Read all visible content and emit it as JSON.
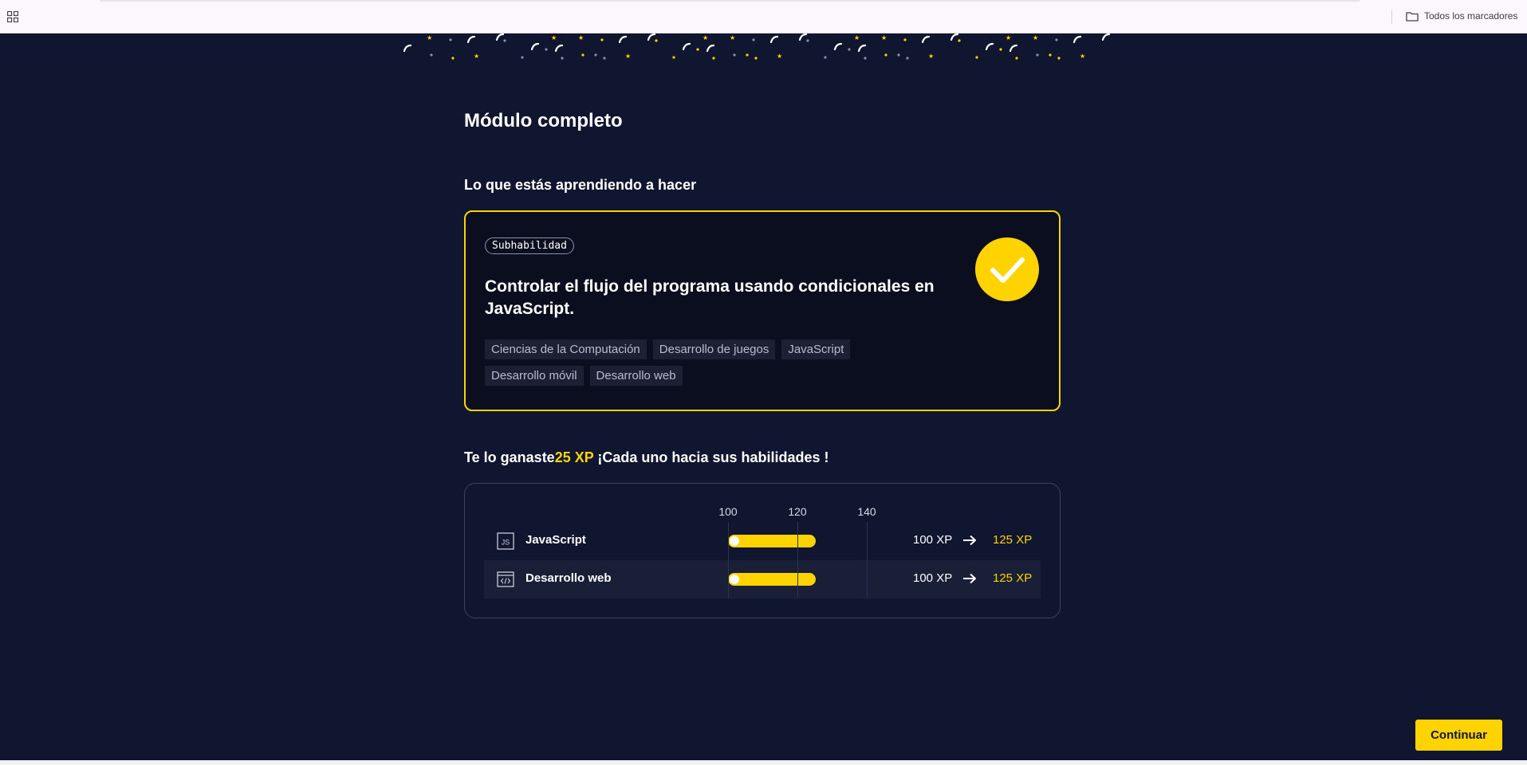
{
  "browser": {
    "bookmarks_label": "Todos los marcadores"
  },
  "page": {
    "title": "Módulo completo",
    "learning_heading": "Lo que estás aprendiendo a hacer",
    "skill_card": {
      "badge": "Subhabilidad",
      "title": "Controlar el flujo del programa usando condicionales en JavaScript.",
      "tags": [
        "Ciencias de la Computación",
        "Desarrollo de juegos",
        "JavaScript",
        "Desarrollo móvil",
        "Desarrollo web"
      ],
      "status_icon": "check-icon"
    },
    "xp_heading": {
      "prefix": "Te lo ganaste",
      "amount": "25 XP",
      "suffix": " ¡Cada uno hacia sus habilidades !"
    },
    "xp_chart": {
      "axis_ticks": [
        "100",
        "120",
        "140"
      ],
      "rows": [
        {
          "icon": "js-file-icon",
          "label": "JavaScript",
          "from": "100 XP",
          "to": "125 XP",
          "from_value": 100,
          "to_value": 125
        },
        {
          "icon": "code-window-icon",
          "label": "Desarrollo web",
          "from": "100 XP",
          "to": "125 XP",
          "from_value": 100,
          "to_value": 125
        }
      ]
    },
    "continue_label": "Continuar"
  },
  "colors": {
    "background": "#10162f",
    "accent": "#ffd300",
    "card": "#0b0e1f"
  }
}
